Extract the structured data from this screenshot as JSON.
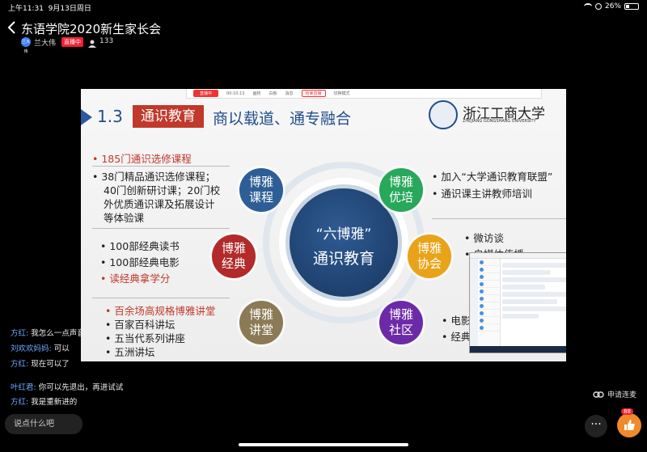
{
  "status": {
    "time": "上午11:31",
    "date": "9月13日周日",
    "battery": "26%"
  },
  "header": {
    "title": "东语学院2020新生家长会",
    "host_avatar": "兰大伟",
    "host_name": "兰大伟",
    "live_badge": "直播中",
    "viewers": "133"
  },
  "toolbar": {
    "recording": "直播中",
    "timer": "00:10:13",
    "item1": "画粉",
    "item2": "白板",
    "item3": "消息",
    "end": "结束直播",
    "switch": "切换模式"
  },
  "slide": {
    "section_num": "1.3",
    "section_title": "通识教育",
    "section_sub": "商以载道、通专融合",
    "uni_cn": "浙江工商大学",
    "uni_en": "ZHEJIANG GONGSHANG UNIVERSITY",
    "core_line1": "“六博雅”",
    "core_line2": "通识教育",
    "left_top_red": "• 185门通识选修课程",
    "left_top_body": [
      "• 38门精品通识选修课程；",
      "40门创新研讨课；20门校",
      "外优质通识课及拓展设计",
      "等体验课"
    ],
    "left_mid": [
      "• 100部经典读书",
      "• 100部经典电影"
    ],
    "left_mid_red": "• 读经典拿学分",
    "left_bot_red": "• 百余场高规格博雅讲堂",
    "left_bot": [
      "• 百家百科讲坛",
      "• 五当代系列讲座",
      "• 五洲讲坛"
    ],
    "right_top": [
      "• 加入“大学通识教育联盟”",
      "• 通识课主讲教师培训"
    ],
    "right_top_red": "大学通识教育联盟",
    "right_mid": [
      "• 微访谈",
      "• 自媒体传播"
    ],
    "right_bot": [
      "• 电影",
      "• 经典"
    ],
    "bubbles": {
      "kecheng": "博雅 课程",
      "youpei": "博雅 优培",
      "jingdian": "博雅 经典",
      "xiehui": "博雅 协会",
      "jiangtang": "博雅 讲堂",
      "shequ": "博雅 社区"
    }
  },
  "chat": [
    {
      "name": "方红:",
      "text": "我怎么一点声音都没有"
    },
    {
      "name": "刘欢欢妈妈:",
      "text": "可以"
    },
    {
      "name": "方红:",
      "text": "现在可以了"
    },
    {
      "name": "叶红君:",
      "text": "你可以先退出，再进试试"
    },
    {
      "name": "方红:",
      "text": "我是重新进的"
    }
  ],
  "input_placeholder": "说点什么吧",
  "apply_link": "申请连麦",
  "more_label": "···",
  "like_count": "88",
  "icons": [
    "back-icon",
    "user-icon",
    "link-icon",
    "thumbs-up-icon",
    "wifi-icon",
    "battery-icon"
  ]
}
